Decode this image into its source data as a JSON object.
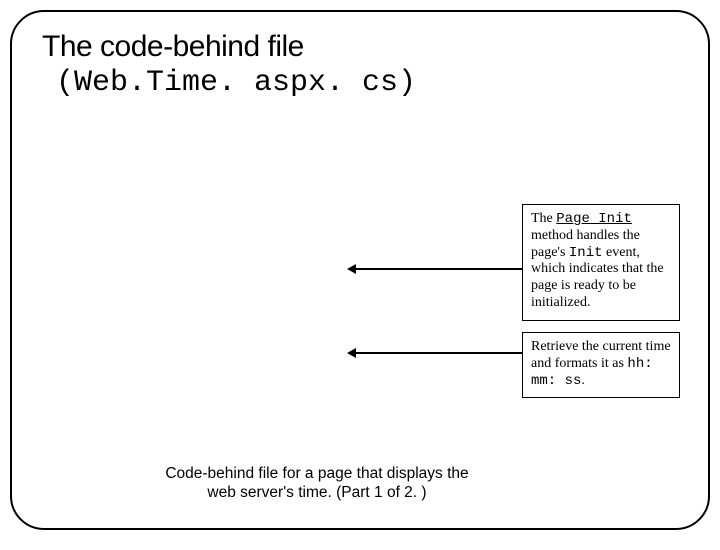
{
  "title": {
    "line1": "The code-behind file",
    "line2": "(Web.Time. aspx. cs)"
  },
  "callout1": {
    "w_the": "The ",
    "code_page_init": "Page_Init",
    "rest": " method handles the page's ",
    "code_init": "Init",
    "rest2": " event, which indicates that the page is ready to be initialized."
  },
  "callout2": {
    "text": "Retrieve the current time and formats it as ",
    "code": "hh: mm: ss",
    "dot": "."
  },
  "caption": "Code-behind file for a page that displays the web server's time. (Part 1 of 2. )"
}
